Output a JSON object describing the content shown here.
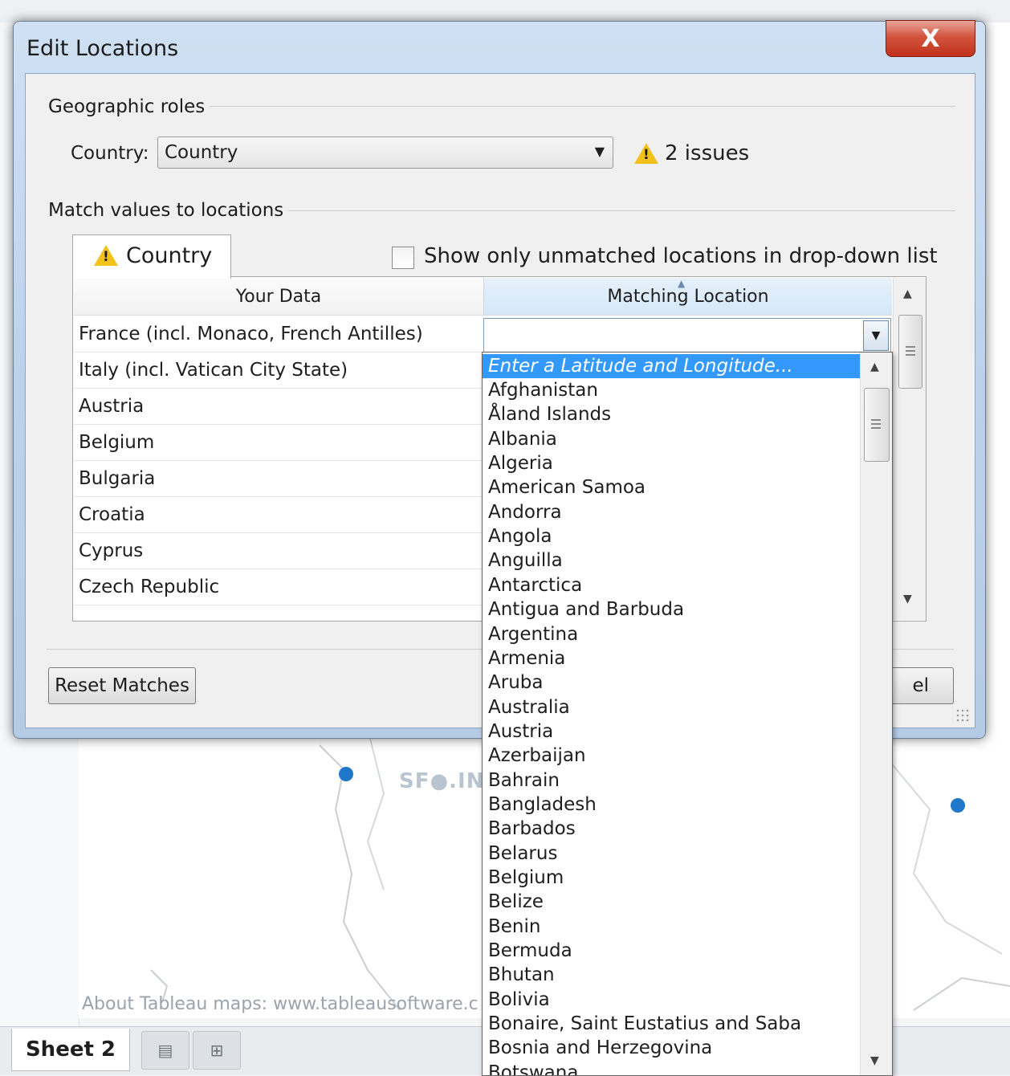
{
  "background": {
    "map_attribution": "About Tableau maps: www.tableausoftware.c",
    "watermark": "SF●.IN",
    "sheet_tab": "Sheet 2",
    "sheet_buttons": [
      "new-worksheet-icon",
      "new-dashboard-icon"
    ]
  },
  "dialog": {
    "title": "Edit Locations",
    "close_label": "X",
    "geographic_roles_label": "Geographic roles",
    "country_field_label": "Country:",
    "country_role_value": "Country",
    "issues_text": "2 issues",
    "match_values_label": "Match values to locations",
    "tab_label": "Country",
    "show_unmatched_label": "Show only unmatched locations in drop-down list",
    "columns": {
      "your_data": "Your Data",
      "matching_location": "Matching Location"
    },
    "rows": [
      "France (incl. Monaco, French Antilles)",
      "Italy (incl. Vatican City State)",
      "Austria",
      "Belgium",
      "Bulgaria",
      "Croatia",
      "Cyprus",
      "Czech Republic"
    ],
    "reset_button": "Reset Matches",
    "cancel_button_visible_fragment": "el"
  },
  "dropdown": {
    "selected": "Enter a Latitude and Longitude...",
    "options": [
      "Afghanistan",
      "Åland Islands",
      "Albania",
      "Algeria",
      "American Samoa",
      "Andorra",
      "Angola",
      "Anguilla",
      "Antarctica",
      "Antigua and Barbuda",
      "Argentina",
      "Armenia",
      "Aruba",
      "Australia",
      "Austria",
      "Azerbaijan",
      "Bahrain",
      "Bangladesh",
      "Barbados",
      "Belarus",
      "Belgium",
      "Belize",
      "Benin",
      "Bermuda",
      "Bhutan",
      "Bolivia",
      "Bonaire, Saint Eustatius and Saba",
      "Bosnia and Herzegovina",
      "Botswana"
    ]
  },
  "colors": {
    "selection": "#3399ff",
    "warning": "#f2c21a",
    "close_button": "#c2311b",
    "map_dot": "#1f77c9"
  }
}
